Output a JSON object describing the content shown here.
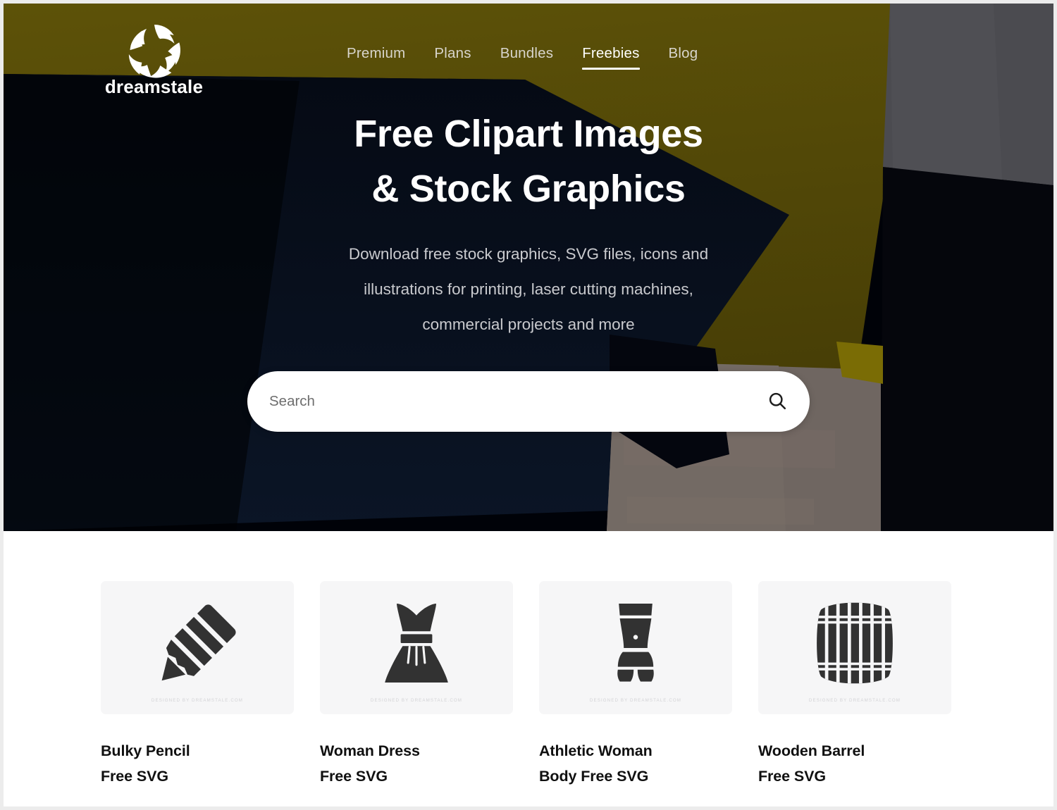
{
  "site": {
    "logo_text": "dreamstale",
    "logo_icon": "aperture-swirl-icon"
  },
  "nav": {
    "items": [
      {
        "label": "Premium",
        "active": false
      },
      {
        "label": "Plans",
        "active": false
      },
      {
        "label": "Bundles",
        "active": false
      },
      {
        "label": "Freebies",
        "active": true
      },
      {
        "label": "Blog",
        "active": false
      }
    ]
  },
  "hero": {
    "title_line1": "Free Clipart Images",
    "title_line2": "& Stock Graphics",
    "subtitle_line1": "Download free stock graphics, SVG files, icons and",
    "subtitle_line2": "illustrations for printing, laser cutting machines,",
    "subtitle_line3": "commercial projects and more"
  },
  "search": {
    "value": "",
    "placeholder": "Search",
    "icon": "search-icon",
    "button_label": ""
  },
  "colors": {
    "hero_black": "#000208",
    "hero_olive": "#554a07",
    "hero_gray": "#4b4b50",
    "hero_navy": "#0a1322",
    "hero_stone": "#6f6661",
    "card_bg": "#f6f6f7",
    "art_fill": "#323232",
    "text_dark": "#101010",
    "text_muted": "#c9cace"
  },
  "cards": [
    {
      "title_line1": "Bulky Pencil",
      "title_line2": "Free SVG",
      "icon": "pencil-icon",
      "watermark": "DESIGNED BY DREAMSTALE.COM"
    },
    {
      "title_line1": "Woman Dress",
      "title_line2": "Free SVG",
      "icon": "dress-icon",
      "watermark": "DESIGNED BY DREAMSTALE.COM"
    },
    {
      "title_line1": "Athletic Woman",
      "title_line2": "Body Free SVG",
      "icon": "female-torso-icon",
      "watermark": "DESIGNED BY DREAMSTALE.COM"
    },
    {
      "title_line1": "Wooden Barrel",
      "title_line2": "Free SVG",
      "icon": "barrel-icon",
      "watermark": "DESIGNED BY DREAMSTALE.COM"
    }
  ]
}
